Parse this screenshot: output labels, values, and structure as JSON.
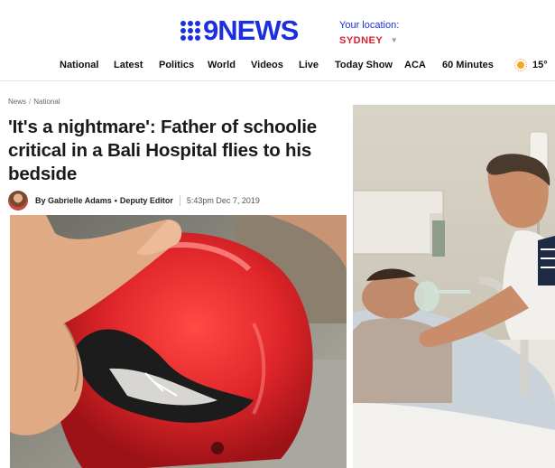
{
  "header": {
    "logo_nine": "9",
    "logo_news": "NEWS",
    "location_label": "Your location:",
    "location_city": "SYDNEY",
    "brand_color": "#1b2fe0",
    "city_color": "#d92131"
  },
  "nav": {
    "items": [
      "National",
      "Latest",
      "Politics",
      "World",
      "Videos",
      "Live",
      "Today Show",
      "ACA",
      "60 Minutes"
    ],
    "weather_icon": "sun-icon",
    "temperature": "15°"
  },
  "breadcrumb": {
    "items": [
      "News",
      "National"
    ],
    "separator": "/"
  },
  "article": {
    "title": "'It's a nightmare': Father of schoolie critical in a Bali Hospital flies to his bedside",
    "byline_prefix": "By Gabrielle Adams",
    "byline_dot": "•",
    "byline_role": "Deputy Editor",
    "date": "5:43pm Dec 7, 2019"
  }
}
